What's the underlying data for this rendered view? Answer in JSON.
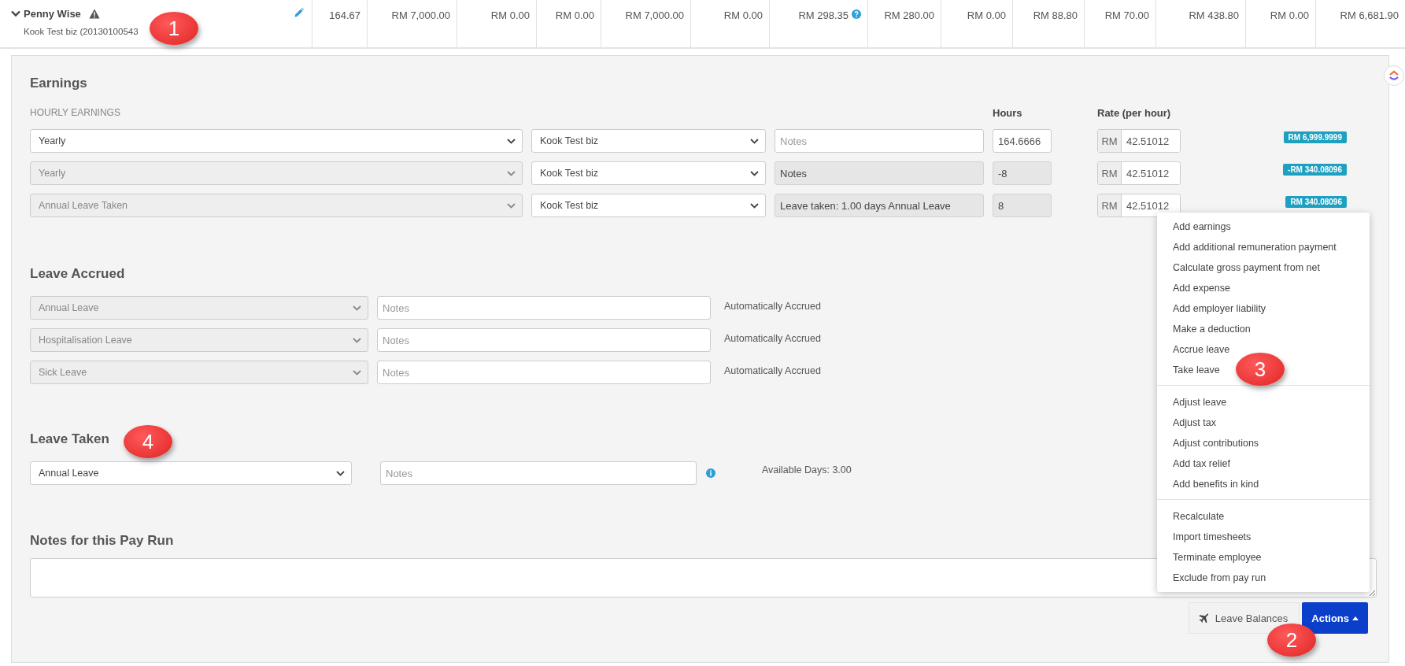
{
  "employee": {
    "name": "Penny Wise",
    "business": "Kook Test biz (20130100543",
    "expanded": true,
    "warning": true
  },
  "summary": [
    {
      "value": "164.67",
      "help": false
    },
    {
      "value": "RM 7,000.00",
      "help": false
    },
    {
      "value": "RM 0.00",
      "help": false
    },
    {
      "value": "RM 0.00",
      "help": false
    },
    {
      "value": "RM 7,000.00",
      "help": false
    },
    {
      "value": "RM 0.00",
      "help": false
    },
    {
      "value": "RM 298.35",
      "help": true
    },
    {
      "value": "RM 280.00",
      "help": false
    },
    {
      "value": "RM 0.00",
      "help": false
    },
    {
      "value": "RM 88.80",
      "help": false
    },
    {
      "value": "RM 70.00",
      "help": false
    },
    {
      "value": "RM 438.80",
      "help": false
    },
    {
      "value": "RM 0.00",
      "help": false
    },
    {
      "value": "RM 6,681.90",
      "help": false
    }
  ],
  "earnings": {
    "title": "Earnings",
    "subtitle": "HOURLY EARNINGS",
    "hours_header": "Hours",
    "rate_header": "Rate (per hour)",
    "rows": [
      {
        "type": "Yearly",
        "type_disabled": false,
        "business": "Kook Test biz",
        "notes": {
          "placeholder": "Notes",
          "disabled": false
        },
        "hours": "164.6666",
        "hours_disabled": false,
        "currency": "RM",
        "rate": "42.51012",
        "amount": "RM 6,999.9999"
      },
      {
        "type": "Yearly",
        "type_disabled": true,
        "business": "Kook Test biz",
        "notes": {
          "placeholder": "Notes",
          "disabled": true
        },
        "hours": "-8",
        "hours_disabled": true,
        "currency": "RM",
        "rate": "42.51012",
        "amount": "-RM 340.08096"
      },
      {
        "type": "Annual Leave Taken",
        "type_disabled": true,
        "business": "Kook Test biz",
        "notes": {
          "value": "Leave taken: 1.00 days Annual Leave",
          "disabled": true
        },
        "hours": "8",
        "hours_disabled": true,
        "currency": "RM",
        "rate": "42.51012",
        "amount": "RM 340.08096"
      }
    ]
  },
  "leave_accrued": {
    "title": "Leave Accrued",
    "rows": [
      {
        "type": "Annual Leave",
        "type_disabled": true,
        "notes_placeholder": "Notes",
        "status": "Automatically Accrued"
      },
      {
        "type": "Hospitalisation Leave",
        "type_disabled": true,
        "notes_placeholder": "Notes",
        "status": "Automatically Accrued"
      },
      {
        "type": "Sick Leave",
        "type_disabled": true,
        "notes_placeholder": "Notes",
        "status": "Automatically Accrued"
      }
    ]
  },
  "leave_taken": {
    "title": "Leave Taken",
    "type": "Annual Leave",
    "type_disabled": false,
    "notes_placeholder": "Notes",
    "available": "Available Days: 3.00"
  },
  "pay_run_notes": {
    "title": "Notes for this Pay Run"
  },
  "leave_balances_button": {
    "label": "Leave Balances"
  },
  "actions_button": {
    "label": "Actions",
    "expanded": true
  },
  "actions_menu": {
    "groups": [
      [
        "Add earnings",
        "Add additional remuneration payment",
        "Calculate gross payment from net",
        "Add expense",
        "Add employer liability",
        "Make a deduction",
        "Accrue leave",
        "Take leave"
      ],
      [
        "Adjust leave",
        "Adjust tax",
        "Adjust contributions",
        "Add tax relief",
        "Add benefits in kind"
      ],
      [
        "Recalculate",
        "Import timesheets",
        "Terminate employee",
        "Exclude from pay run"
      ]
    ]
  },
  "callouts": [
    "1",
    "2",
    "3",
    "4"
  ]
}
